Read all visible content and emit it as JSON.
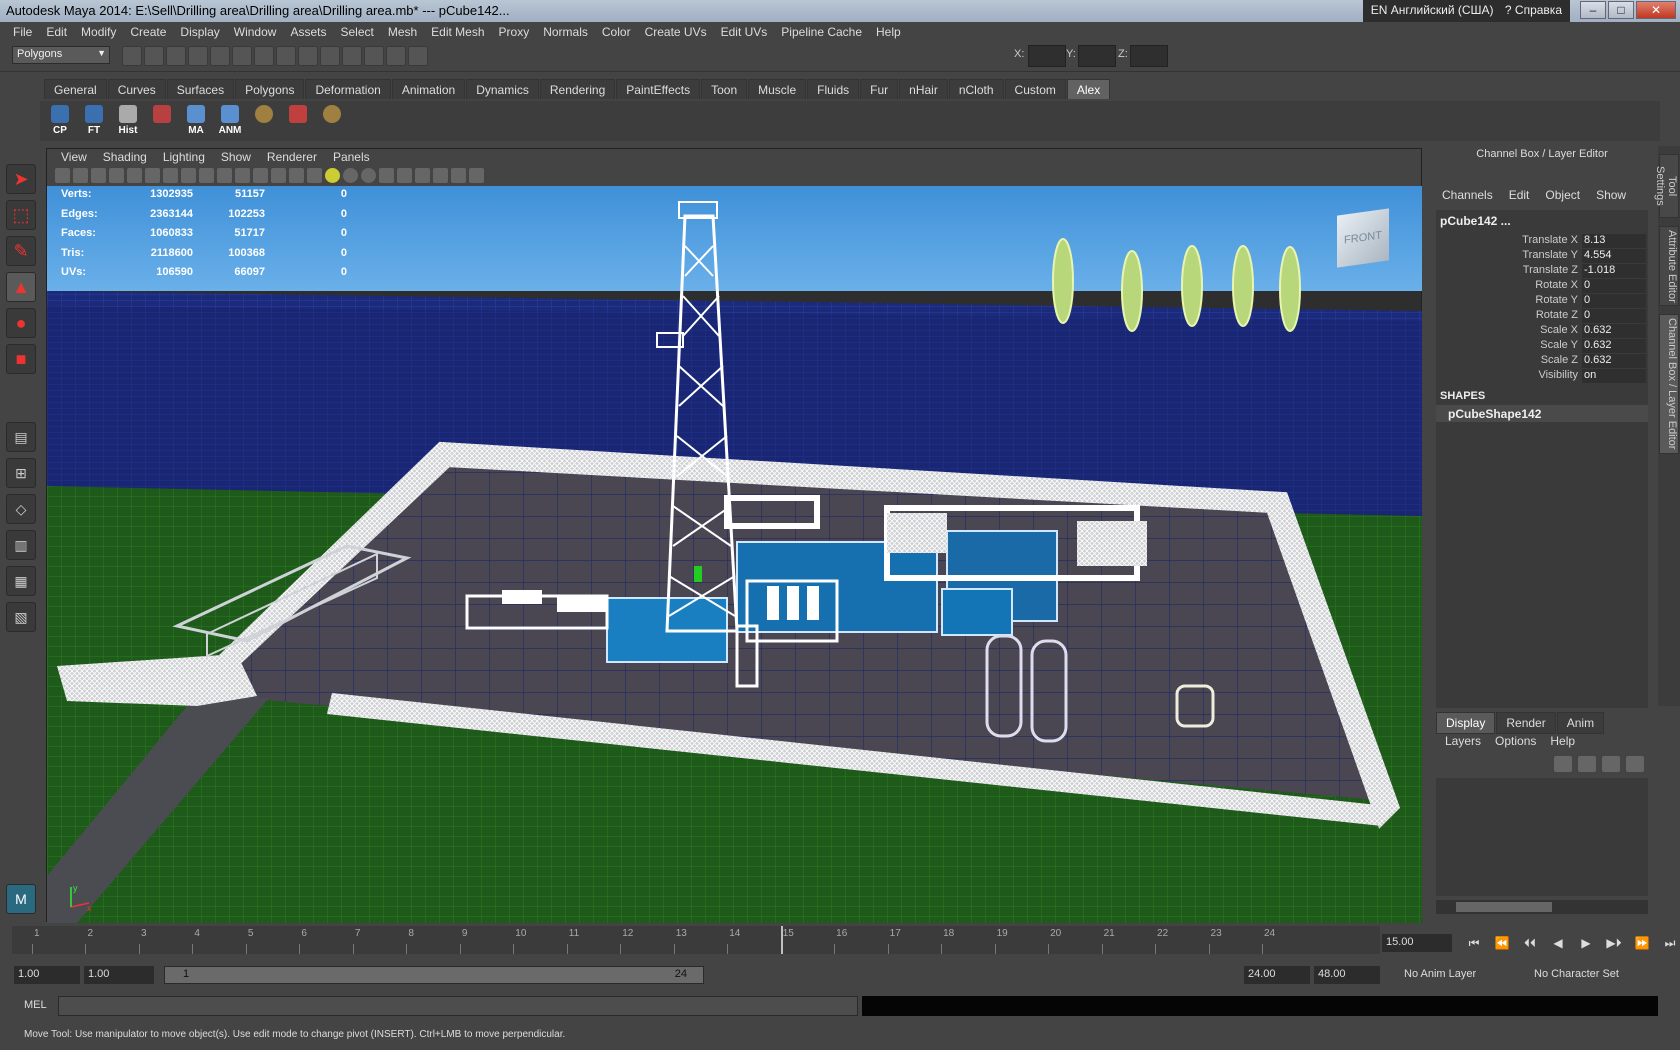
{
  "title": "Autodesk Maya 2014: E:\\Sell\\Drilling area\\Drilling area\\Drilling area.mb*   ---   pCube142...",
  "lang_indicator": "EN Английский (США)",
  "help_label": "Справка",
  "window_controls": {
    "minimize": "–",
    "maximize": "□",
    "close": "✕"
  },
  "menubar": [
    "File",
    "Edit",
    "Modify",
    "Create",
    "Display",
    "Window",
    "Assets",
    "Select",
    "Mesh",
    "Edit Mesh",
    "Proxy",
    "Normals",
    "Color",
    "Create UVs",
    "Edit UVs",
    "Pipeline Cache",
    "Help"
  ],
  "mode_selector": "Polygons",
  "coord_labels": {
    "x": "X:",
    "y": "Y:",
    "z": "Z:"
  },
  "shelf_tabs": [
    "General",
    "Curves",
    "Surfaces",
    "Polygons",
    "Deformation",
    "Animation",
    "Dynamics",
    "Rendering",
    "PaintEffects",
    "Toon",
    "Muscle",
    "Fluids",
    "Fur",
    "nHair",
    "nCloth",
    "Custom",
    "Alex"
  ],
  "active_shelf": "Alex",
  "shelf_buttons": [
    {
      "label": "CP",
      "icon": "pivot-icon",
      "color": "#3a6fb0"
    },
    {
      "label": "FT",
      "icon": "freeze-icon",
      "color": "#3a6fb0"
    },
    {
      "label": "Hist",
      "icon": "history-icon",
      "color": "#aaaaaa"
    },
    {
      "label": "",
      "icon": "ruler-icon",
      "color": "#b84040"
    },
    {
      "label": "MA",
      "icon": "ma-icon",
      "color": "#5a8fd0"
    },
    {
      "label": "ANM",
      "icon": "anm-icon",
      "color": "#5a8fd0"
    },
    {
      "label": "",
      "icon": "gear-icon",
      "color": "#a08040"
    },
    {
      "label": "",
      "icon": "paint-icon",
      "color": "#c04040"
    },
    {
      "label": "",
      "icon": "sphere-icon",
      "color": "#a08040"
    }
  ],
  "viewport": {
    "menu": [
      "View",
      "Shading",
      "Lighting",
      "Show",
      "Renderer",
      "Panels"
    ],
    "hud": [
      {
        "label": "Verts:",
        "v1": "1302935",
        "v2": "51157",
        "v3": "0"
      },
      {
        "label": "Edges:",
        "v1": "2363144",
        "v2": "102253",
        "v3": "0"
      },
      {
        "label": "Faces:",
        "v1": "1060833",
        "v2": "51717",
        "v3": "0"
      },
      {
        "label": "Tris:",
        "v1": "2118600",
        "v2": "100368",
        "v3": "0"
      },
      {
        "label": "UVs:",
        "v1": "106590",
        "v2": "66097",
        "v3": "0"
      }
    ],
    "viewcube_label": "FRONT",
    "axis_labels": {
      "x": "x",
      "y": "y"
    }
  },
  "channel_box": {
    "title": "Channel Box / Layer Editor",
    "menu": [
      "Channels",
      "Edit",
      "Object",
      "Show"
    ],
    "object_name": "pCube142 ...",
    "attributes": [
      {
        "name": "Translate X",
        "value": "8.13"
      },
      {
        "name": "Translate Y",
        "value": "4.554"
      },
      {
        "name": "Translate Z",
        "value": "-1.018"
      },
      {
        "name": "Rotate X",
        "value": "0"
      },
      {
        "name": "Rotate Y",
        "value": "0"
      },
      {
        "name": "Rotate Z",
        "value": "0"
      },
      {
        "name": "Scale X",
        "value": "0.632"
      },
      {
        "name": "Scale Y",
        "value": "0.632"
      },
      {
        "name": "Scale Z",
        "value": "0.632"
      },
      {
        "name": "Visibility",
        "value": "on"
      }
    ],
    "shapes_label": "SHAPES",
    "shape_name": "pCubeShape142"
  },
  "layer_editor": {
    "tabs": [
      "Display",
      "Render",
      "Anim"
    ],
    "active_tab": "Display",
    "menu": [
      "Layers",
      "Options",
      "Help"
    ]
  },
  "side_tabs": [
    "Tool Settings",
    "Attribute Editor",
    "Channel Box / Layer Editor"
  ],
  "timeline": {
    "ticks": [
      "1",
      "2",
      "3",
      "4",
      "5",
      "6",
      "7",
      "8",
      "9",
      "10",
      "11",
      "12",
      "13",
      "14",
      "15",
      "16",
      "17",
      "18",
      "19",
      "20",
      "21",
      "22",
      "23",
      "24"
    ],
    "current_frame": "15.00"
  },
  "playback_buttons": [
    "⏮",
    "⏪",
    "⏴⏴",
    "◀",
    "▶",
    "▶⏵",
    "⏩",
    "⏭"
  ],
  "range": {
    "start": "1.00",
    "playback_start": "1.00",
    "slider_start": "1",
    "slider_end": "24",
    "playback_end": "24.00",
    "end": "48.00",
    "anim_layer": "No Anim Layer",
    "char_set": "No Character Set"
  },
  "mel_label": "MEL",
  "help_line": "Move Tool: Use manipulator to move object(s). Use edit mode to change pivot (INSERT).  Ctrl+LMB to move perpendicular."
}
